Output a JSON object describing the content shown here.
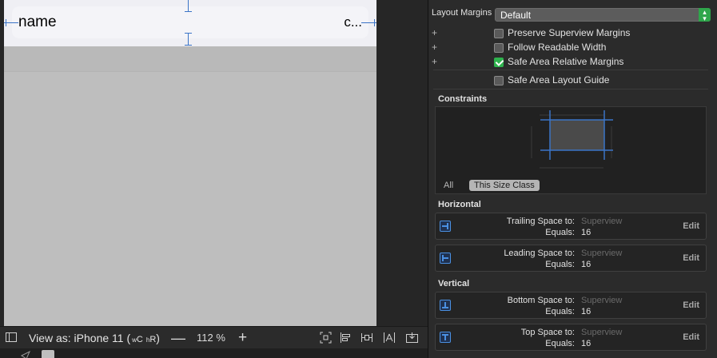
{
  "canvas": {
    "cell": {
      "title": "name",
      "detail": "c..."
    }
  },
  "bottom_bar": {
    "device_prefix": "View as: iPhone 11 (",
    "compact_w": "w",
    "compact_c": "C",
    "regular_h": "h",
    "regular_r": "R",
    "device_suffix": ")",
    "zoom_minus": "—",
    "zoom_value": "112 %",
    "zoom_plus": "+"
  },
  "inspector": {
    "layout_margins": {
      "label": "Layout Margins",
      "value": "Default"
    },
    "checkboxes": [
      {
        "label": "Preserve Superview Margins",
        "checked": false,
        "has_plus": true
      },
      {
        "label": "Follow Readable Width",
        "checked": false,
        "has_plus": true
      },
      {
        "label": "Safe Area Relative Margins",
        "checked": true,
        "has_plus": true
      },
      {
        "label": "Safe Area Layout Guide",
        "checked": false,
        "has_plus": false
      }
    ],
    "constraints": {
      "title": "Constraints",
      "filter_all": "All",
      "filter_size_class": "This Size Class"
    },
    "horizontal": {
      "title": "Horizontal",
      "items": [
        {
          "key": "Trailing Space to:",
          "target": "Superview",
          "equals_label": "Equals:",
          "equals_value": "16",
          "edit": "Edit"
        },
        {
          "key": "Leading Space to:",
          "target": "Superview",
          "equals_label": "Equals:",
          "equals_value": "16",
          "edit": "Edit"
        }
      ]
    },
    "vertical": {
      "title": "Vertical",
      "items": [
        {
          "key": "Bottom Space to:",
          "target": "Superview",
          "equals_label": "Equals:",
          "equals_value": "16",
          "edit": "Edit"
        },
        {
          "key": "Top Space to:",
          "target": "Superview",
          "equals_label": "Equals:",
          "equals_value": "16",
          "edit": "Edit"
        }
      ]
    }
  },
  "colors": {
    "accent_blue": "#3b74c7",
    "checkbox_green": "#2fb34e",
    "inspector_bg": "#2b2b2b"
  },
  "icons": [
    "document-outline-icon",
    "zoom-fit-icon",
    "align-icon",
    "pin-icon",
    "resolve-icon",
    "embed-icon",
    "updown-chevron-icon",
    "trailing-constraint-icon",
    "leading-constraint-icon",
    "bottom-constraint-icon",
    "top-constraint-icon"
  ]
}
